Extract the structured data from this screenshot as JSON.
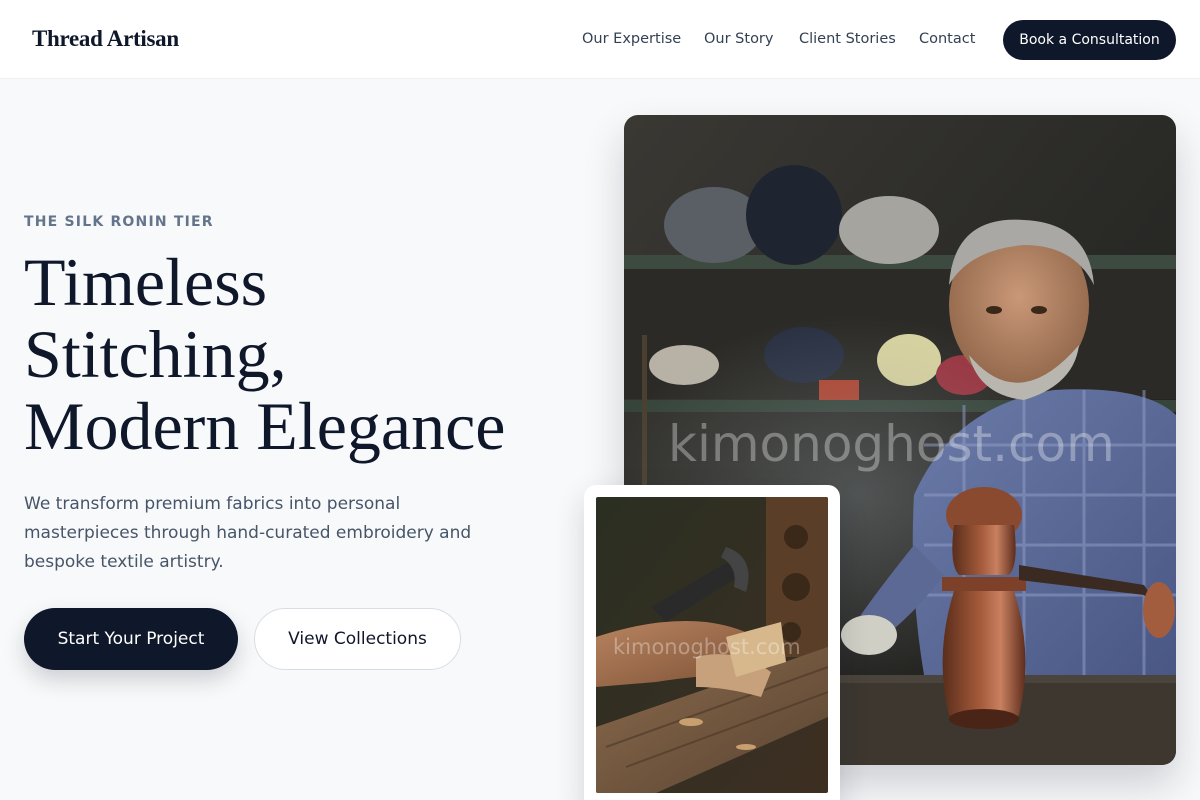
{
  "brand": {
    "name": "Thread Artisan"
  },
  "nav": {
    "items": [
      {
        "label": "Our Expertise"
      },
      {
        "label": "Our Story"
      },
      {
        "label": "Client Stories"
      },
      {
        "label": "Contact"
      }
    ],
    "cta_label": "Book a Consultation"
  },
  "hero": {
    "eyebrow": "THE SILK RONIN TIER",
    "headline_lines": [
      "Timeless",
      "Stitching,",
      "Modern Elegance"
    ],
    "subtext": "We transform premium fabrics into personal masterpieces through hand-curated embroidery and bespoke textile artistry.",
    "primary_button": "Start Your Project",
    "secondary_button": "View Collections"
  },
  "images": {
    "main_watermark": "kimonoghost.com",
    "inset_watermark": "kimonoghost.com"
  },
  "colors": {
    "primary_dark": "#0f172a",
    "background": "#f8f9fa",
    "muted_text": "#64748b"
  }
}
